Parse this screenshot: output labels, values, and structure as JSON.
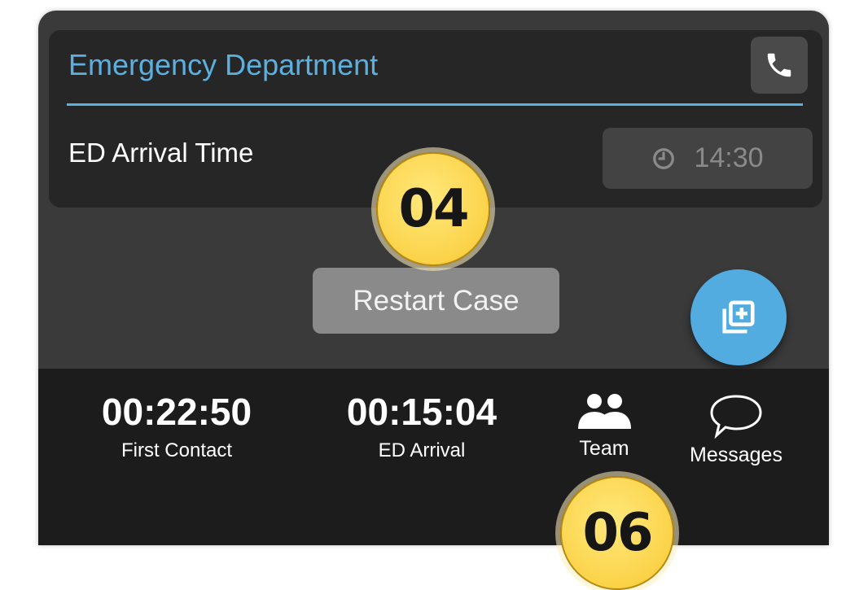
{
  "ed_card": {
    "title": "Emergency Department",
    "arrival_label": "ED Arrival Time",
    "arrival_time_value": "14:30"
  },
  "actions": {
    "restart_label": "Restart Case"
  },
  "bottom_bar": {
    "first_contact": {
      "value": "00:22:50",
      "label": "First Contact"
    },
    "ed_arrival": {
      "value": "00:15:04",
      "label": "ED Arrival"
    },
    "team_label": "Team",
    "messages_label": "Messages"
  },
  "badges": {
    "badge_04": "04",
    "badge_06": "06"
  },
  "icons": {
    "phone": "phone-icon",
    "clock": "clock-icon",
    "add_case": "add-layers-icon",
    "team": "team-icon",
    "messages": "speech-bubble-icon"
  },
  "colors": {
    "accent": "#5bb0e0",
    "fab": "#52ace0",
    "badge": "#fbd349",
    "card_bg": "#262626",
    "bar_bg": "#1c1c1c"
  }
}
